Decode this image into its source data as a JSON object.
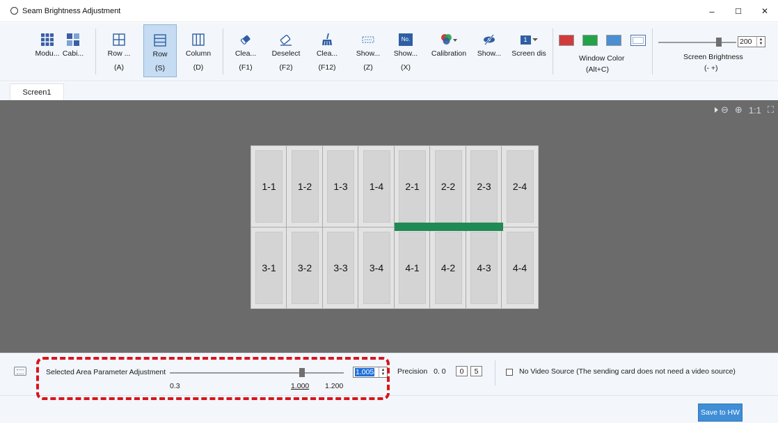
{
  "window": {
    "title": "Seam Brightness Adjustment",
    "controls": {
      "minimize": "–",
      "maximize": "☐",
      "close": "✕"
    }
  },
  "toolbar": {
    "tools": [
      {
        "id": "module",
        "label": "Modu...",
        "key": "",
        "icon": "module-grid-icon"
      },
      {
        "id": "cabinet",
        "label": "Cabi...",
        "key": "",
        "icon": "cabinet-grid-icon"
      },
      {
        "id": "row-col",
        "label": "Row ...",
        "key": "(A)",
        "icon": "row-column-icon"
      },
      {
        "id": "row",
        "label": "Row",
        "key": "(S)",
        "icon": "row-icon",
        "active": true
      },
      {
        "id": "column",
        "label": "Column",
        "key": "(D)",
        "icon": "column-icon"
      },
      {
        "id": "clear",
        "label": "Clea...",
        "key": "(F1)",
        "icon": "eraser-icon"
      },
      {
        "id": "deselect",
        "label": "Deselect",
        "key": "(F2)",
        "icon": "eraser-outline-icon"
      },
      {
        "id": "clear-all",
        "label": "Clea...",
        "key": "(F12)",
        "icon": "broom-icon"
      },
      {
        "id": "show-seam",
        "label": "Show...",
        "key": "(Z)",
        "icon": "dashed-rect-icon"
      },
      {
        "id": "show-no",
        "label": "Show...",
        "key": "(X)",
        "icon": "number-icon"
      },
      {
        "id": "calibration",
        "label": "Calibration",
        "key": "",
        "icon": "rgb-circles-icon"
      },
      {
        "id": "show-hide",
        "label": "Show...",
        "key": "",
        "icon": "eye-off-icon"
      },
      {
        "id": "screen-dis",
        "label": "Screen dis",
        "key": "",
        "icon": "screen-number-icon"
      }
    ],
    "number_icon_text": "No.",
    "screen_icon_text": "1",
    "window_color": {
      "label": "Window Color",
      "key": "(Alt+C)",
      "swatches": [
        "#d23b3b",
        "#22a34a",
        "#4a8fd1",
        "#ffffff"
      ]
    },
    "screen_brightness": {
      "label": "Screen Brightness",
      "key": "(-  +)",
      "value": "200",
      "level": 0.78
    }
  },
  "tabs": [
    {
      "label": "Screen1"
    }
  ],
  "zoom": {
    "fit_label": "1:1"
  },
  "grid": {
    "rows": [
      [
        "1-1",
        "1-2",
        "1-3",
        "1-4",
        "2-1",
        "2-2",
        "2-3",
        "2-4"
      ],
      [
        "3-1",
        "3-2",
        "3-3",
        "3-4",
        "4-1",
        "4-2",
        "4-3",
        "4-4"
      ]
    ],
    "seam_color": "#1f8a53"
  },
  "bottom": {
    "param_label": "Selected Area Parameter Adjustment",
    "param_value": "1.005",
    "slider_level": 0.76,
    "tick_min": "0.3",
    "tick_mid": "1.000",
    "tick_max": "1.200",
    "precision_label": "Precision",
    "precision_prefix": "0. 0",
    "precision_digits": [
      "0",
      "5"
    ],
    "no_video_label": "No Video Source (The sending card does not need a video source)",
    "save_label": "Save to HW"
  }
}
